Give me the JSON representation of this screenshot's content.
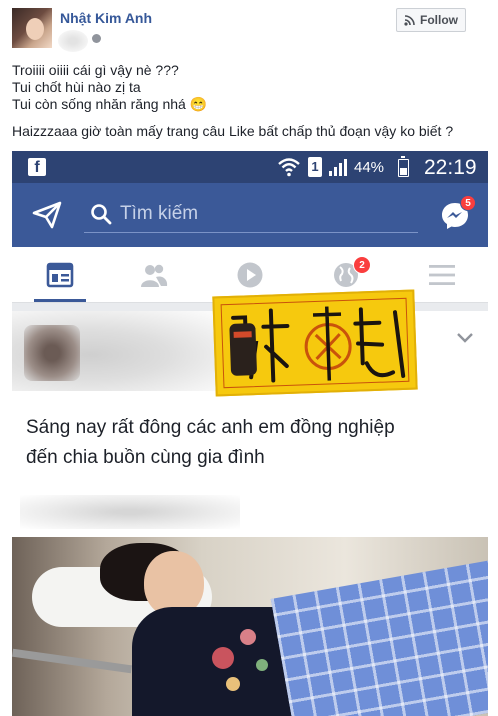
{
  "post": {
    "author": "Nhật Kim Anh",
    "follow_label": "Follow",
    "caption_lines": [
      "Troiiii oiiii cái gì vậy nè ???",
      "Tui chốt hùi nào zị ta",
      "Tui còn sống nhăn răng nhá 😁",
      "Haizzzaaa giờ toàn mấy trang câu Like bất chấp thủ đoạn vậy ko biết ?"
    ]
  },
  "phone": {
    "status_bar": {
      "sim_label": "1",
      "battery_text": "44%",
      "battery_level": 0.44,
      "time": "22:19",
      "fb_glyph": "f"
    },
    "search": {
      "placeholder": "Tìm kiếm",
      "messenger_badge": "5"
    },
    "tabs": [
      {
        "name": "news-feed",
        "icon": "news-feed-icon",
        "active": true
      },
      {
        "name": "friends",
        "icon": "friends-icon",
        "active": false
      },
      {
        "name": "video",
        "icon": "play-icon",
        "active": false
      },
      {
        "name": "notifications",
        "icon": "globe-icon",
        "badge": "2",
        "active": false
      },
      {
        "name": "menu",
        "icon": "hamburger-icon",
        "active": false
      }
    ],
    "story": {
      "text_line_1": "Sáng nay rất đông các anh em đồng nghiệp",
      "text_line_2": "đến chia buồn   cùng  gia  đình"
    }
  },
  "colors": {
    "facebook_blue": "#3b5998",
    "status_bar_blue": "#2d4373",
    "link_blue": "#365899",
    "badge_red": "#fa3e3e",
    "talisman_yellow": "#f6c90e"
  }
}
